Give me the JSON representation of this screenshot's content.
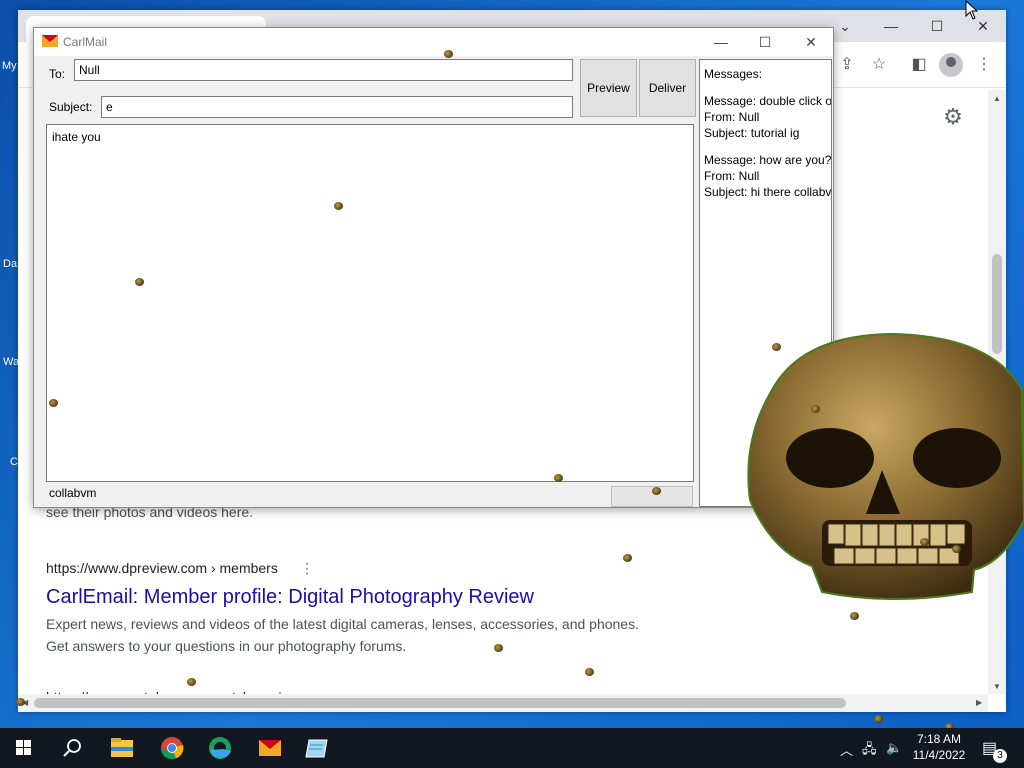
{
  "desktop": {
    "icon_labels": [
      "My",
      "Da",
      "Wa",
      "C"
    ]
  },
  "browser": {
    "search_results": {
      "partial_snippet": "see their photos and videos here.",
      "results": [
        {
          "url": "https://www.dpreview.com › members",
          "title": "CarlEmail: Member profile: Digital Photography Review",
          "description_lines": [
            "Expert news, reviews and videos of the latest digital cameras, lenses, accessories, and phones.",
            "Get answers to your questions in our photography forums."
          ]
        },
        {
          "url": "https://www.youtube.com › watch"
        }
      ]
    }
  },
  "carlmail": {
    "title": "CarlMail",
    "to_label": "To:",
    "to_value": "Null",
    "subject_label": "Subject:",
    "subject_value": "e",
    "body_text": "ihate you",
    "preview_label": "Preview",
    "deliver_label": "Deliver",
    "status_text": "collabvm",
    "messages_header": "Messages:",
    "messages": [
      {
        "message": "Message: double click o",
        "from": "From: Null",
        "subject": "Subject: tutorial ig"
      },
      {
        "message": "Message: how are you? t",
        "from": "From: Null",
        "subject": "Subject: hi there collabv"
      }
    ]
  },
  "taskbar": {
    "clock_time": "7:18 AM",
    "clock_date": "11/4/2022",
    "notification_count": "3"
  },
  "colors": {
    "link": "#1a0dab",
    "taskbar": "#11181f",
    "desktop": "#1a78d8"
  },
  "icons": [
    "windows-start-icon",
    "search-icon",
    "file-explorer-icon",
    "chrome-icon",
    "edge-icon",
    "carlmail-icon",
    "notepad-icon",
    "chevron-up-icon",
    "network-icon",
    "volume-icon",
    "notification-icon",
    "gear-icon",
    "skull-image"
  ]
}
